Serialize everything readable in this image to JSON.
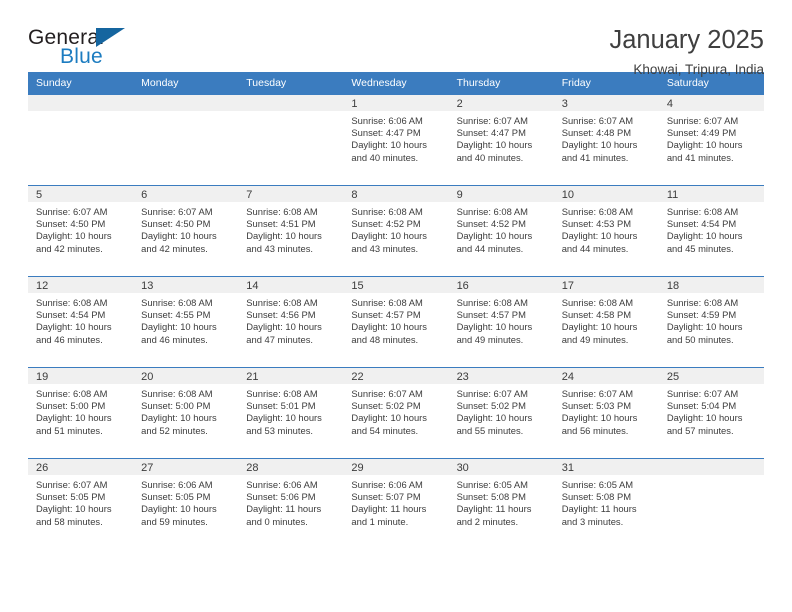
{
  "brand": {
    "name_top": "General",
    "name_bottom": "Blue",
    "top_color": "#231f20",
    "bottom_color": "#1c7cc0",
    "triangle_color": "#15659f"
  },
  "header": {
    "title": "January 2025",
    "subtitle": "Khowai, Tripura, India"
  },
  "theme": {
    "header_blue": "#3b7cbf",
    "date_band": "#f0f0f0",
    "text": "#3c3c3c"
  },
  "calendar": {
    "weekday_headers": [
      "Sunday",
      "Monday",
      "Tuesday",
      "Wednesday",
      "Thursday",
      "Friday",
      "Saturday"
    ],
    "weeks": [
      [
        {
          "day": "",
          "sunrise": "",
          "sunset": "",
          "daylight": "",
          "daylight2": ""
        },
        {
          "day": "",
          "sunrise": "",
          "sunset": "",
          "daylight": "",
          "daylight2": ""
        },
        {
          "day": "",
          "sunrise": "",
          "sunset": "",
          "daylight": "",
          "daylight2": ""
        },
        {
          "day": "1",
          "sunrise": "Sunrise: 6:06 AM",
          "sunset": "Sunset: 4:47 PM",
          "daylight": "Daylight: 10 hours",
          "daylight2": "and 40 minutes."
        },
        {
          "day": "2",
          "sunrise": "Sunrise: 6:07 AM",
          "sunset": "Sunset: 4:47 PM",
          "daylight": "Daylight: 10 hours",
          "daylight2": "and 40 minutes."
        },
        {
          "day": "3",
          "sunrise": "Sunrise: 6:07 AM",
          "sunset": "Sunset: 4:48 PM",
          "daylight": "Daylight: 10 hours",
          "daylight2": "and 41 minutes."
        },
        {
          "day": "4",
          "sunrise": "Sunrise: 6:07 AM",
          "sunset": "Sunset: 4:49 PM",
          "daylight": "Daylight: 10 hours",
          "daylight2": "and 41 minutes."
        }
      ],
      [
        {
          "day": "5",
          "sunrise": "Sunrise: 6:07 AM",
          "sunset": "Sunset: 4:50 PM",
          "daylight": "Daylight: 10 hours",
          "daylight2": "and 42 minutes."
        },
        {
          "day": "6",
          "sunrise": "Sunrise: 6:07 AM",
          "sunset": "Sunset: 4:50 PM",
          "daylight": "Daylight: 10 hours",
          "daylight2": "and 42 minutes."
        },
        {
          "day": "7",
          "sunrise": "Sunrise: 6:08 AM",
          "sunset": "Sunset: 4:51 PM",
          "daylight": "Daylight: 10 hours",
          "daylight2": "and 43 minutes."
        },
        {
          "day": "8",
          "sunrise": "Sunrise: 6:08 AM",
          "sunset": "Sunset: 4:52 PM",
          "daylight": "Daylight: 10 hours",
          "daylight2": "and 43 minutes."
        },
        {
          "day": "9",
          "sunrise": "Sunrise: 6:08 AM",
          "sunset": "Sunset: 4:52 PM",
          "daylight": "Daylight: 10 hours",
          "daylight2": "and 44 minutes."
        },
        {
          "day": "10",
          "sunrise": "Sunrise: 6:08 AM",
          "sunset": "Sunset: 4:53 PM",
          "daylight": "Daylight: 10 hours",
          "daylight2": "and 44 minutes."
        },
        {
          "day": "11",
          "sunrise": "Sunrise: 6:08 AM",
          "sunset": "Sunset: 4:54 PM",
          "daylight": "Daylight: 10 hours",
          "daylight2": "and 45 minutes."
        }
      ],
      [
        {
          "day": "12",
          "sunrise": "Sunrise: 6:08 AM",
          "sunset": "Sunset: 4:54 PM",
          "daylight": "Daylight: 10 hours",
          "daylight2": "and 46 minutes."
        },
        {
          "day": "13",
          "sunrise": "Sunrise: 6:08 AM",
          "sunset": "Sunset: 4:55 PM",
          "daylight": "Daylight: 10 hours",
          "daylight2": "and 46 minutes."
        },
        {
          "day": "14",
          "sunrise": "Sunrise: 6:08 AM",
          "sunset": "Sunset: 4:56 PM",
          "daylight": "Daylight: 10 hours",
          "daylight2": "and 47 minutes."
        },
        {
          "day": "15",
          "sunrise": "Sunrise: 6:08 AM",
          "sunset": "Sunset: 4:57 PM",
          "daylight": "Daylight: 10 hours",
          "daylight2": "and 48 minutes."
        },
        {
          "day": "16",
          "sunrise": "Sunrise: 6:08 AM",
          "sunset": "Sunset: 4:57 PM",
          "daylight": "Daylight: 10 hours",
          "daylight2": "and 49 minutes."
        },
        {
          "day": "17",
          "sunrise": "Sunrise: 6:08 AM",
          "sunset": "Sunset: 4:58 PM",
          "daylight": "Daylight: 10 hours",
          "daylight2": "and 49 minutes."
        },
        {
          "day": "18",
          "sunrise": "Sunrise: 6:08 AM",
          "sunset": "Sunset: 4:59 PM",
          "daylight": "Daylight: 10 hours",
          "daylight2": "and 50 minutes."
        }
      ],
      [
        {
          "day": "19",
          "sunrise": "Sunrise: 6:08 AM",
          "sunset": "Sunset: 5:00 PM",
          "daylight": "Daylight: 10 hours",
          "daylight2": "and 51 minutes."
        },
        {
          "day": "20",
          "sunrise": "Sunrise: 6:08 AM",
          "sunset": "Sunset: 5:00 PM",
          "daylight": "Daylight: 10 hours",
          "daylight2": "and 52 minutes."
        },
        {
          "day": "21",
          "sunrise": "Sunrise: 6:08 AM",
          "sunset": "Sunset: 5:01 PM",
          "daylight": "Daylight: 10 hours",
          "daylight2": "and 53 minutes."
        },
        {
          "day": "22",
          "sunrise": "Sunrise: 6:07 AM",
          "sunset": "Sunset: 5:02 PM",
          "daylight": "Daylight: 10 hours",
          "daylight2": "and 54 minutes."
        },
        {
          "day": "23",
          "sunrise": "Sunrise: 6:07 AM",
          "sunset": "Sunset: 5:02 PM",
          "daylight": "Daylight: 10 hours",
          "daylight2": "and 55 minutes."
        },
        {
          "day": "24",
          "sunrise": "Sunrise: 6:07 AM",
          "sunset": "Sunset: 5:03 PM",
          "daylight": "Daylight: 10 hours",
          "daylight2": "and 56 minutes."
        },
        {
          "day": "25",
          "sunrise": "Sunrise: 6:07 AM",
          "sunset": "Sunset: 5:04 PM",
          "daylight": "Daylight: 10 hours",
          "daylight2": "and 57 minutes."
        }
      ],
      [
        {
          "day": "26",
          "sunrise": "Sunrise: 6:07 AM",
          "sunset": "Sunset: 5:05 PM",
          "daylight": "Daylight: 10 hours",
          "daylight2": "and 58 minutes."
        },
        {
          "day": "27",
          "sunrise": "Sunrise: 6:06 AM",
          "sunset": "Sunset: 5:05 PM",
          "daylight": "Daylight: 10 hours",
          "daylight2": "and 59 minutes."
        },
        {
          "day": "28",
          "sunrise": "Sunrise: 6:06 AM",
          "sunset": "Sunset: 5:06 PM",
          "daylight": "Daylight: 11 hours",
          "daylight2": "and 0 minutes."
        },
        {
          "day": "29",
          "sunrise": "Sunrise: 6:06 AM",
          "sunset": "Sunset: 5:07 PM",
          "daylight": "Daylight: 11 hours",
          "daylight2": "and 1 minute."
        },
        {
          "day": "30",
          "sunrise": "Sunrise: 6:05 AM",
          "sunset": "Sunset: 5:08 PM",
          "daylight": "Daylight: 11 hours",
          "daylight2": "and 2 minutes."
        },
        {
          "day": "31",
          "sunrise": "Sunrise: 6:05 AM",
          "sunset": "Sunset: 5:08 PM",
          "daylight": "Daylight: 11 hours",
          "daylight2": "and 3 minutes."
        },
        {
          "day": "",
          "sunrise": "",
          "sunset": "",
          "daylight": "",
          "daylight2": ""
        }
      ]
    ]
  }
}
